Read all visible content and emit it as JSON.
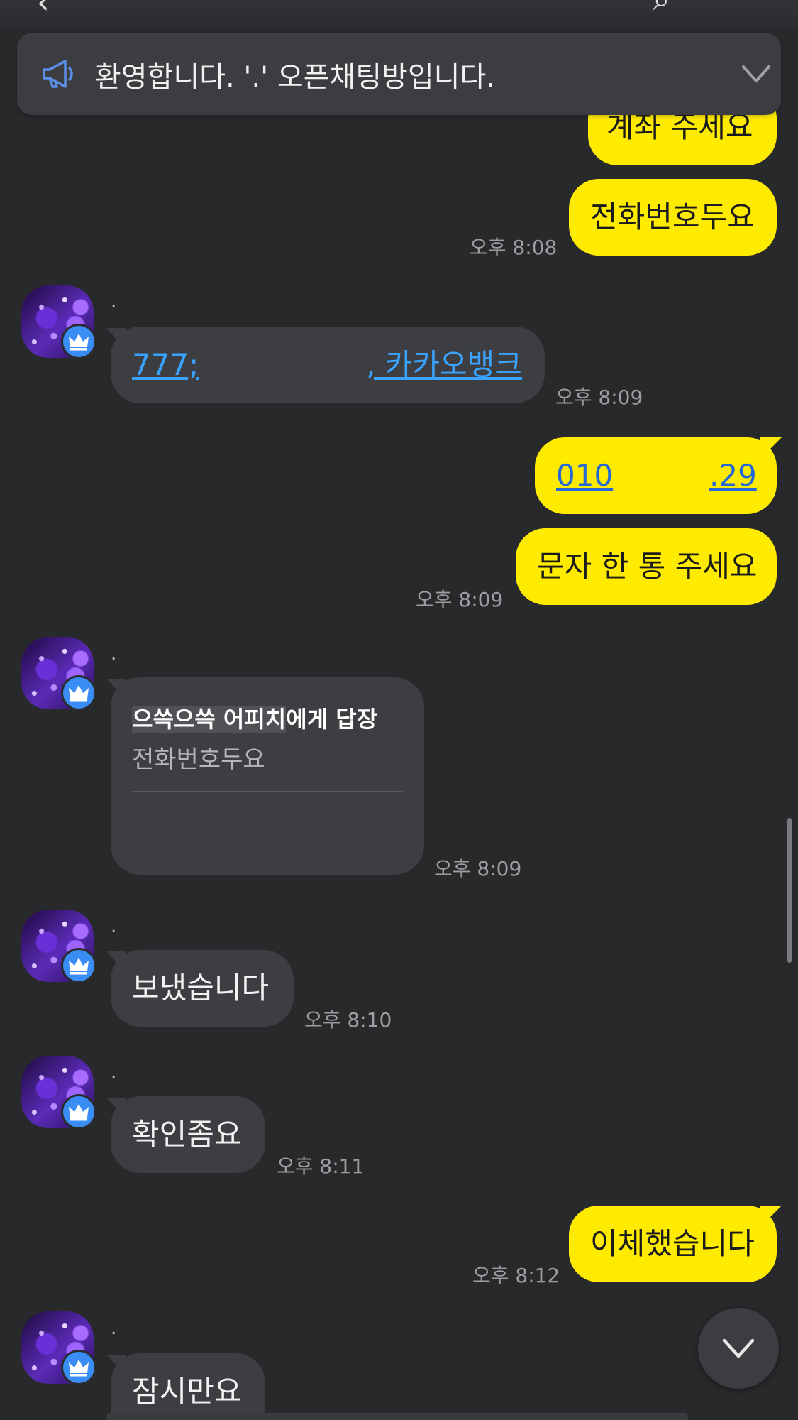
{
  "notice": {
    "text": "환영합니다. '.' 오픈채팅방입니다."
  },
  "messages": {
    "m1": {
      "text": "계좌 주세요"
    },
    "m2": {
      "text": "전화번호두요",
      "time": "오후 8:08"
    },
    "m3": {
      "sender": ".",
      "link_left": "777;",
      "link_right": ", 카카오뱅크",
      "time": "오후 8:09"
    },
    "m4": {
      "link_left": "010",
      "link_right": ".29"
    },
    "m5": {
      "text": "문자 한 통 주세요",
      "time": "오후 8:09"
    },
    "m6": {
      "sender": ".",
      "reply_to_name_hl": "으쓱으쓱 어피치",
      "reply_to_suffix": "에게 답장",
      "reply_quote": "전화번호두요",
      "time": "오후 8:09"
    },
    "m7": {
      "sender": ".",
      "text": "보냈습니다",
      "time": "오후 8:10"
    },
    "m8": {
      "sender": ".",
      "text": "확인좀요",
      "time": "오후 8:11"
    },
    "m9": {
      "text": "이체했습니다",
      "time": "오후 8:12"
    },
    "m10": {
      "sender": ".",
      "text": "잠시만요"
    }
  },
  "colors": {
    "background": "#28292b",
    "my_bubble": "#ffeb00",
    "their_bubble": "#3d3e41",
    "link": "#3aa2ff",
    "crown_badge": "#3a8df5"
  },
  "icons": {
    "notice": "megaphone-icon",
    "notice_toggle": "chevron-down-icon",
    "badge": "crown-icon",
    "scroll": "chevron-down-icon"
  }
}
